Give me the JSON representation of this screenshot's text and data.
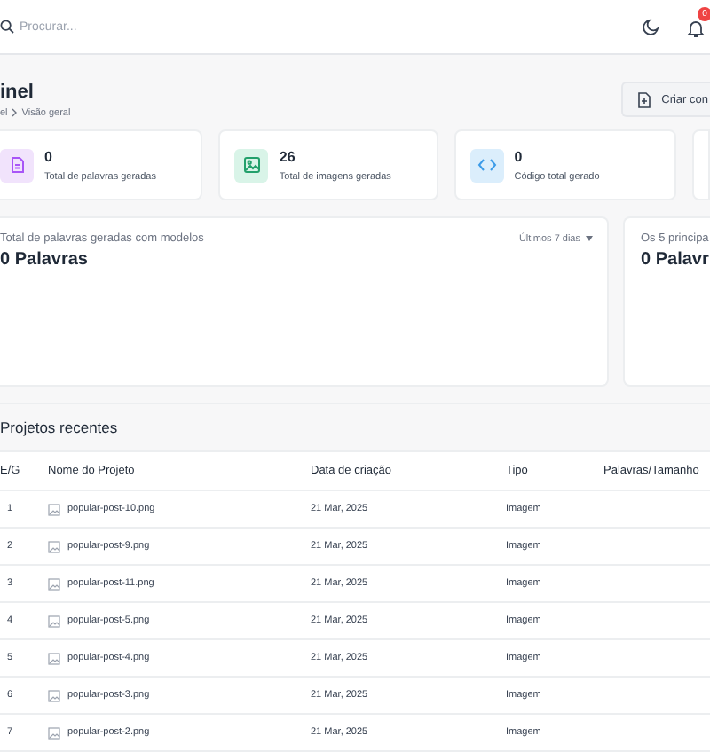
{
  "topbar": {
    "search": {
      "placeholder": "Procurar..."
    },
    "notification_badge": "0"
  },
  "header": {
    "title": "inel",
    "breadcrumb": [
      "el",
      "Visão geral"
    ],
    "button": "Criar con"
  },
  "stats": [
    {
      "kind": "words",
      "value": "0",
      "label": "Total de palavras geradas"
    },
    {
      "kind": "images",
      "value": "26",
      "label": "Total de imagens geradas"
    },
    {
      "kind": "code",
      "value": "0",
      "label": "Código total gerado"
    }
  ],
  "charts": [
    {
      "subtitle": "Total de palavras geradas com modelos",
      "value": "0 Palavras",
      "period": "Últimos 7 dias"
    },
    {
      "subtitle": "Os 5 principa",
      "value": "0 Palavr"
    }
  ],
  "recent": {
    "title": "Projetos recentes",
    "columns": [
      "E/G",
      "Nome do Projeto",
      "Data de criação",
      "Tipo",
      "Palavras/Tamanho"
    ],
    "rows": [
      {
        "index": "1",
        "name": "popular-post-10.png",
        "date": "21 Mar, 2025",
        "type": "Imagem"
      },
      {
        "index": "2",
        "name": "popular-post-9.png",
        "date": "21 Mar, 2025",
        "type": "Imagem"
      },
      {
        "index": "3",
        "name": "popular-post-11.png",
        "date": "21 Mar, 2025",
        "type": "Imagem"
      },
      {
        "index": "4",
        "name": "popular-post-5.png",
        "date": "21 Mar, 2025",
        "type": "Imagem"
      },
      {
        "index": "5",
        "name": "popular-post-4.png",
        "date": "21 Mar, 2025",
        "type": "Imagem"
      },
      {
        "index": "6",
        "name": "popular-post-3.png",
        "date": "21 Mar, 2025",
        "type": "Imagem"
      },
      {
        "index": "7",
        "name": "popular-post-2.png",
        "date": "21 Mar, 2025",
        "type": "Imagem"
      }
    ]
  }
}
